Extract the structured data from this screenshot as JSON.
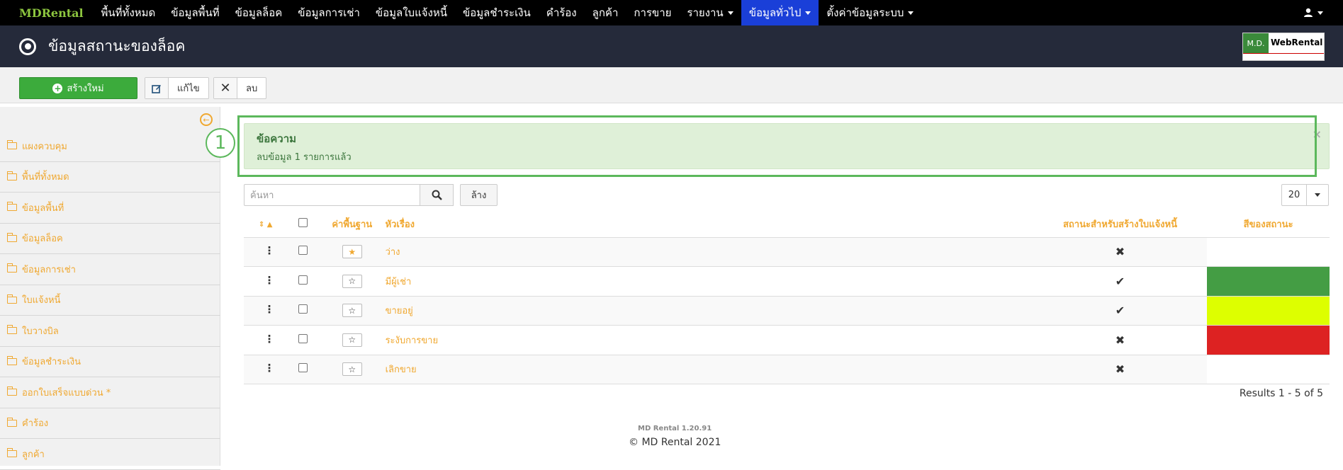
{
  "brand": "MDRental",
  "nav": {
    "items": [
      {
        "label": "พื้นที่ทั้งหมด",
        "active": false,
        "dropdown": false
      },
      {
        "label": "ข้อมูลพื้นที่",
        "active": false,
        "dropdown": false
      },
      {
        "label": "ข้อมูลล็อค",
        "active": false,
        "dropdown": false
      },
      {
        "label": "ข้อมูลการเช่า",
        "active": false,
        "dropdown": false
      },
      {
        "label": "ข้อมูลใบแจ้งหนี้",
        "active": false,
        "dropdown": false
      },
      {
        "label": "ข้อมูลชำระเงิน",
        "active": false,
        "dropdown": false
      },
      {
        "label": "คำร้อง",
        "active": false,
        "dropdown": false
      },
      {
        "label": "ลูกค้า",
        "active": false,
        "dropdown": false
      },
      {
        "label": "การขาย",
        "active": false,
        "dropdown": false
      },
      {
        "label": "รายงาน",
        "active": false,
        "dropdown": true
      },
      {
        "label": "ข้อมูลทั่วไป",
        "active": true,
        "dropdown": true
      },
      {
        "label": "ตั้งค่าข้อมูลระบบ",
        "active": false,
        "dropdown": true
      }
    ],
    "user_icon": "user-icon"
  },
  "header": {
    "title": "ข้อมูลสถานะของล็อค",
    "logo_md": "M.D.",
    "logo_name": "WebRental"
  },
  "toolbar": {
    "create_label": "สร้างใหม่",
    "edit_label": "แก้ไข",
    "delete_label": "ลบ"
  },
  "sidebar": {
    "items": [
      {
        "label": "แผงควบคุม"
      },
      {
        "label": "พื้นที่ทั้งหมด"
      },
      {
        "label": "ข้อมูลพื้นที่"
      },
      {
        "label": "ข้อมูลล็อค"
      },
      {
        "label": "ข้อมูลการเช่า"
      },
      {
        "label": "ใบแจ้งหนี้"
      },
      {
        "label": "ใบวางบิล"
      },
      {
        "label": "ข้อมูลชำระเงิน"
      },
      {
        "label": "ออกใบเสร็จแบบด่วน *"
      },
      {
        "label": "คำร้อง"
      },
      {
        "label": "ลูกค้า"
      }
    ]
  },
  "annotation": {
    "number": "1"
  },
  "alert": {
    "title": "ข้อความ",
    "message": "ลบข้อมูล 1 รายการแล้ว",
    "close": "×"
  },
  "search": {
    "placeholder": "ค้นหา",
    "clear_label": "ล้าง",
    "limit_value": "20"
  },
  "table": {
    "headers": {
      "default": "ค่าพื้นฐาน",
      "title": "หัวเรื่อง",
      "invoice_status": "สถานะสำหรับสร้างใบแจ้งหนี้",
      "status_color": "สีของสถานะ"
    },
    "rows": [
      {
        "title": "ว่าง",
        "is_default": true,
        "invoice_enabled": false,
        "color": ""
      },
      {
        "title": "มีผู้เช่า",
        "is_default": false,
        "invoice_enabled": true,
        "color": "#449d44"
      },
      {
        "title": "ขายอยู่",
        "is_default": false,
        "invoice_enabled": true,
        "color": "#ddff00"
      },
      {
        "title": "ระงับการขาย",
        "is_default": false,
        "invoice_enabled": false,
        "color": "#dd2222"
      },
      {
        "title": "เลิกขาย",
        "is_default": false,
        "invoice_enabled": false,
        "color": ""
      }
    ]
  },
  "results_text": "Results 1 - 5 of 5",
  "footer": {
    "version": "MD Rental 1.20.91",
    "copyright": "© MD Rental 2021"
  }
}
